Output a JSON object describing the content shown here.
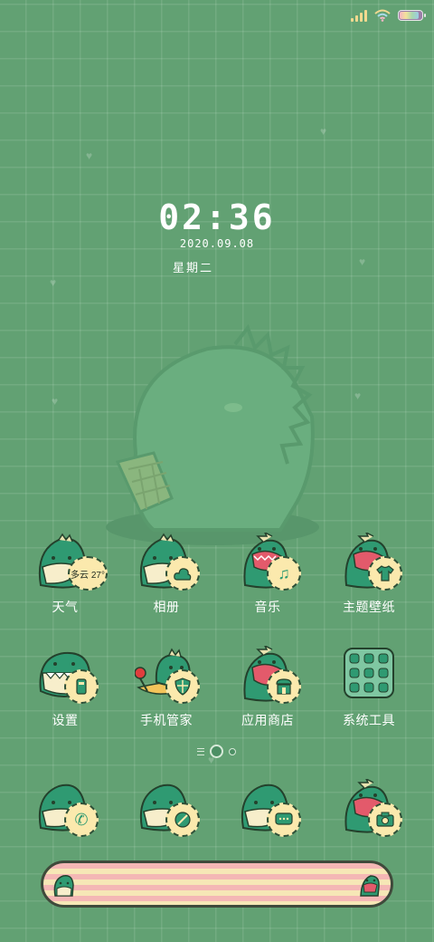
{
  "clock": {
    "time": "02:36",
    "date": "2020.09.08",
    "weekday": "星期二"
  },
  "weather_widget": {
    "text": "多云 27°"
  },
  "apps": [
    {
      "label": "天气"
    },
    {
      "label": "相册"
    },
    {
      "label": "音乐"
    },
    {
      "label": "主题壁纸"
    },
    {
      "label": "设置"
    },
    {
      "label": "手机管家"
    },
    {
      "label": "应用商店"
    },
    {
      "label": "系统工具"
    }
  ],
  "dock": [
    {
      "icon": "phone-icon"
    },
    {
      "icon": "compass-icon"
    },
    {
      "icon": "message-icon"
    },
    {
      "icon": "camera-icon"
    }
  ],
  "page_indicator": {
    "total_pages": 2,
    "current_page": 1
  },
  "colors": {
    "background": "#62a173",
    "dino": "#2f9a72",
    "badge": "#fbe9ad",
    "outline": "#2d4f37"
  }
}
